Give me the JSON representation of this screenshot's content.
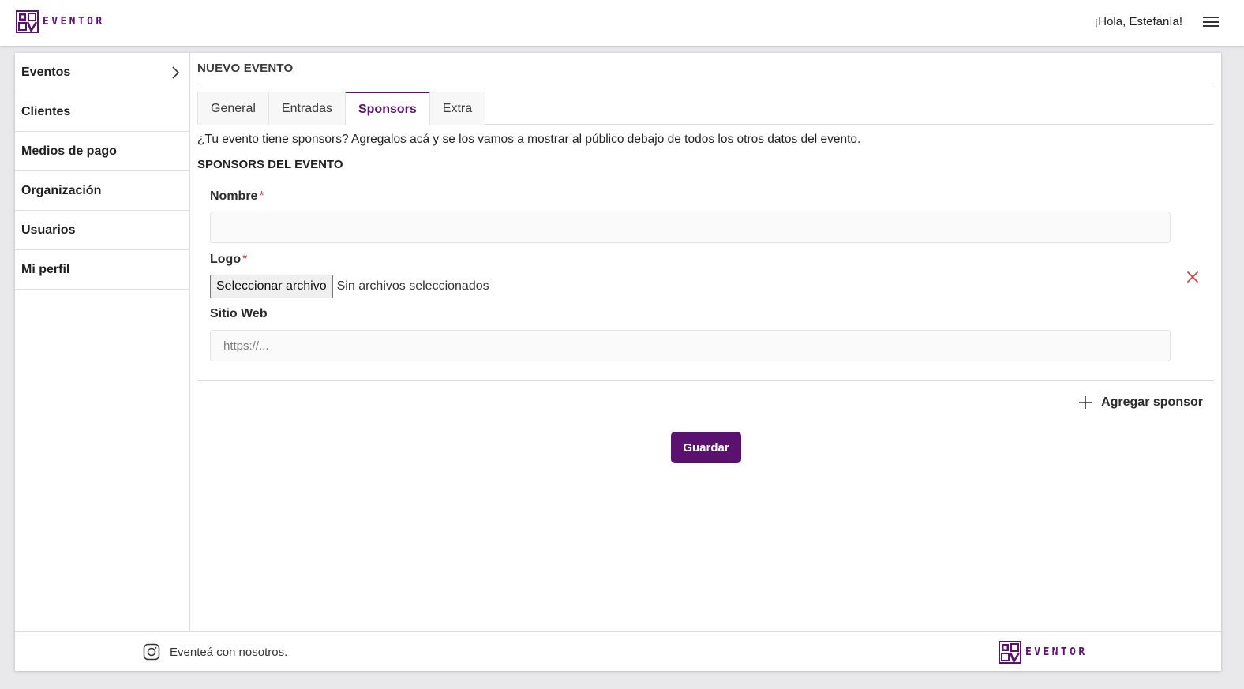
{
  "brand": {
    "name": "EVENTOR",
    "color": "#5a1170"
  },
  "header": {
    "greeting": "¡Hola, Estefanía!",
    "menu_icon": "hamburger-icon"
  },
  "sidebar": {
    "items": [
      {
        "label": "Eventos",
        "icon": "chevron-right-icon"
      },
      {
        "label": "Clientes"
      },
      {
        "label": "Medios de pago"
      },
      {
        "label": "Organización"
      },
      {
        "label": "Usuarios"
      },
      {
        "label": "Mi perfil"
      }
    ]
  },
  "main": {
    "title": "NUEVO EVENTO",
    "tabs": [
      {
        "label": "General",
        "active": false
      },
      {
        "label": "Entradas",
        "active": false
      },
      {
        "label": "Sponsors",
        "active": true
      },
      {
        "label": "Extra",
        "active": false
      }
    ],
    "intro": "¿Tu evento tiene sponsors? Agregalos acá y se los vamos a mostrar al público debajo de todos los otros datos del evento.",
    "section_title": "SPONSORS DEL EVENTO",
    "form": {
      "nombre_label": "Nombre",
      "required_mark": "*",
      "nombre_value": "",
      "logo_label": "Logo",
      "file_button": "Seleccionar archivo",
      "file_status": "Sin archivos seleccionados",
      "sitio_label": "Sitio Web",
      "sitio_placeholder": "https://...",
      "remove_icon": "close-icon",
      "remove_color": "#d23c3c"
    },
    "add_sponsor_label": "Agregar sponsor",
    "save_label": "Guardar"
  },
  "footer": {
    "text": "Eventeá con nosotros.",
    "social_icon": "instagram-icon"
  }
}
